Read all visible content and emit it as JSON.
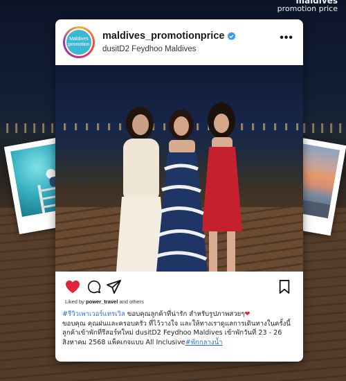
{
  "brand": {
    "line1": "maldives",
    "line2": "promotion price"
  },
  "post": {
    "username": "maldives_promotionprice",
    "location": "dusitD2 Feydhoo Maldives",
    "avatar_text_1": "Maldives",
    "avatar_text_2": "promotion",
    "liked_prefix": "Liked by ",
    "liked_user": "power_travel",
    "liked_suffix": " and others",
    "caption": {
      "hashtag_1": "#รีวิวเพาเวอร์แทรเวิล",
      "text_1": " ขอบคุณลูกค้าที่น่ารัก สำหรับรูปภาพสวยๆ",
      "heart": "❤",
      "text_2": "ขอบคุณ คุณฝนและครอบครัว ที่ไว้วางใจ และให้ทางเราดูแลการเดินทางในครั้งนี้ ลูกค้าเข้าพักที่รีสอร์ทใหม่ dusitD2 Feydhoo Maldives เข้าพักวันที่ 23 - 26 สิงหาคม 2568 แพ็คเกจแบบ All Inclusive",
      "hashtag_2": "#พักกลางน้ำ"
    }
  },
  "colors": {
    "like_red": "#e0243b",
    "link_blue": "#2b6fd6",
    "verified_blue": "#3897f0"
  },
  "icons": [
    "more-icon",
    "heart-icon",
    "comment-icon",
    "share-icon",
    "bookmark-icon",
    "verified-icon"
  ]
}
